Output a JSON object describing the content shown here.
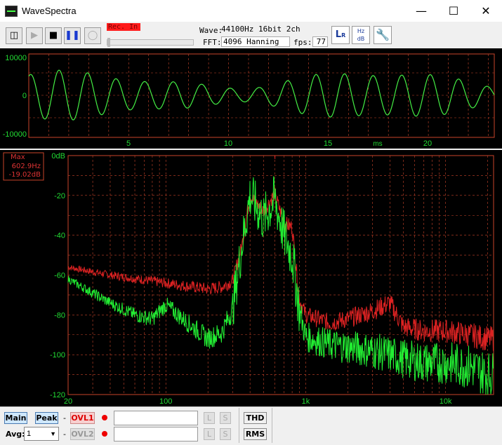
{
  "window": {
    "title": "WaveSpectra"
  },
  "toolbar": {
    "rec_status": "Rec. In",
    "wave_label": "Wave:",
    "wave_value": "44100Hz 16bit 2ch",
    "fft_label": "FFT:",
    "fft_value": "4096 Hanning",
    "fps_label": "fps:",
    "fps_value": "77"
  },
  "icons": [
    "mixer-icon",
    "play-icon",
    "stop-icon",
    "pause-icon",
    "loop-icon",
    "lr-channel-icon",
    "hz-db-icon",
    "settings-wrench-icon"
  ],
  "waveform": {
    "y_ticks": [
      "10000",
      "0",
      "-10000"
    ],
    "x_ticks": [
      "5",
      "10",
      "15",
      "20"
    ],
    "x_unit": "ms",
    "color": "#44ee44",
    "grid_color": "#c8442a"
  },
  "spectrum": {
    "y_ticks": [
      "0dB",
      "-20",
      "-40",
      "-60",
      "-80",
      "-100",
      "-120"
    ],
    "x_ticks": [
      "20",
      "100",
      "1k",
      "10k"
    ],
    "peak_label": {
      "title": "Max",
      "freq": "602.9Hz",
      "level": "-19.02dB"
    },
    "colors": {
      "max": "#dd2222",
      "current": "#22ee33"
    }
  },
  "chart_data": {
    "type": "line",
    "title": "",
    "xlabel": "",
    "ylabel": "",
    "xscale": "log",
    "xlim": [
      20,
      22050
    ],
    "ylim": [
      -120,
      0
    ],
    "series": [
      {
        "x": [
          20,
          40,
          80,
          100,
          200,
          250,
          300,
          350,
          400,
          500,
          600,
          700,
          800,
          900,
          1000,
          1500,
          2000,
          3000,
          4000,
          5000,
          7000,
          10000,
          15000,
          20000
        ],
        "y": [
          -56,
          -60,
          -63,
          -64,
          -67,
          -66,
          -63,
          -45,
          -20,
          -28,
          -19,
          -34,
          -36,
          -72,
          -80,
          -84,
          -82,
          -78,
          -74,
          -86,
          -88,
          -88,
          -90,
          -92
        ]
      },
      {
        "x": [
          20,
          40,
          60,
          80,
          100,
          150,
          200,
          250,
          300,
          350,
          400,
          500,
          600,
          700,
          800,
          900,
          1000,
          1500,
          2000,
          3000,
          4000,
          5000,
          7000,
          10000,
          15000,
          20000
        ],
        "y": [
          -62,
          -74,
          -80,
          -82,
          -75,
          -85,
          -92,
          -89,
          -77,
          -45,
          -20,
          -32,
          -22,
          -40,
          -50,
          -77,
          -91,
          -95,
          -96,
          -98,
          -100,
          -102,
          -104,
          -104,
          -106,
          -110
        ]
      }
    ]
  },
  "bottom": {
    "main_label": "Main",
    "peak_label": "Peak",
    "dash": "-",
    "ovl1_label": "OVL1",
    "ovl2_label": "OVL2",
    "avg_label": "Avg:",
    "avg_value": "1",
    "l_label": "L",
    "s_label": "S",
    "thd_label": "THD",
    "rms_label": "RMS"
  }
}
